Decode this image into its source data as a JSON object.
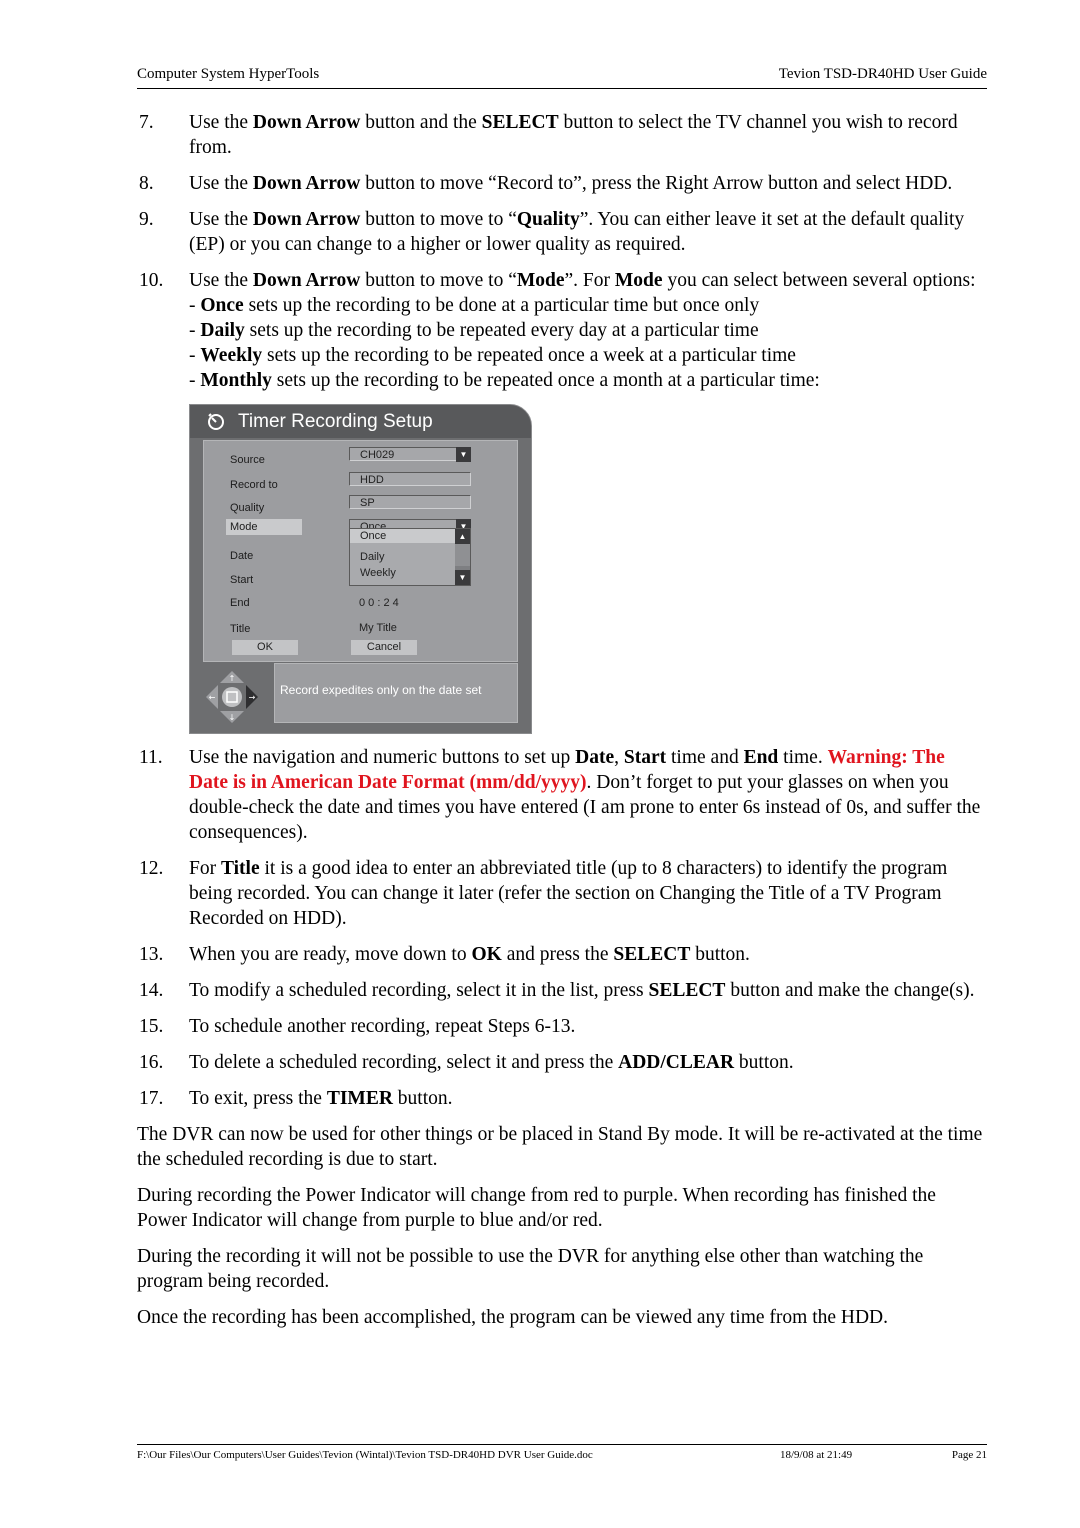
{
  "header": {
    "left": "Computer System HyperTools",
    "right": "Tevion TSD-DR40HD User Guide"
  },
  "steps": [
    {
      "num": "7.",
      "parts": [
        [
          "Use the ",
          false
        ],
        [
          "Down Arrow",
          true
        ],
        [
          " button and the ",
          false
        ],
        [
          "SELECT",
          true
        ],
        [
          " button to select the TV channel you wish to record from.",
          false
        ]
      ]
    },
    {
      "num": "8.",
      "parts": [
        [
          "Use the ",
          false
        ],
        [
          "Down Arrow",
          true
        ],
        [
          " button to move “Record to”, press the Right Arrow button and select HDD.",
          false
        ]
      ]
    },
    {
      "num": "9.",
      "parts": [
        [
          "Use the ",
          false
        ],
        [
          "Down Arrow",
          true
        ],
        [
          " button to move to “",
          false
        ],
        [
          "Quality",
          true
        ],
        [
          "”. You can either leave it set at the default quality (EP) or you can change to a higher or lower quality as required.",
          false
        ]
      ]
    },
    {
      "num": "10.",
      "parts": [
        [
          "Use the ",
          false
        ],
        [
          "Down Arrow",
          true
        ],
        [
          " button to move to “",
          false
        ],
        [
          "Mode",
          true
        ],
        [
          "”. For ",
          false
        ],
        [
          "Mode",
          true
        ],
        [
          " you can select between several options:",
          false
        ]
      ],
      "options": [
        {
          "term": "Once",
          "desc": " sets up the recording to be done at a particular time but once only"
        },
        {
          "term": "Daily",
          "desc": " sets up the recording to be repeated every day at a particular time"
        },
        {
          "term": "Weekly",
          "desc": " sets up the recording to be repeated once a week at a particular time"
        },
        {
          "term": "Monthly",
          "desc": " sets up the recording to be repeated once a month at a particular time:"
        }
      ]
    }
  ],
  "screenshot": {
    "title": "Timer Recording Setup",
    "labels": {
      "source": "Source",
      "record_to": "Record to",
      "quality": "Quality",
      "mode": "Mode",
      "date": "Date",
      "start": "Start",
      "end": "End",
      "title": "Title"
    },
    "values": {
      "source": "CH029",
      "record_to": "HDD",
      "quality": "SP",
      "mode": "Once",
      "end": "0 0 : 2 4",
      "title": "My Title"
    },
    "mode_options": [
      "Once",
      "Daily",
      "Weekly"
    ],
    "ok": "OK",
    "cancel": "Cancel",
    "message": "Record expedites only on the date set",
    "dropdown_arrow": "▼",
    "scroll_up": "▲",
    "scroll_down": "▼"
  },
  "steps2": [
    {
      "num": "11.",
      "parts": [
        [
          "Use the navigation and numeric buttons to set up ",
          false
        ],
        [
          "Date",
          true
        ],
        [
          ", ",
          false
        ],
        [
          "Start",
          true
        ],
        [
          " time and ",
          false
        ],
        [
          "End",
          true
        ],
        [
          " time. ",
          false
        ]
      ],
      "warning": "Warning: The Date is in American Date Format (mm/dd/yyyy)",
      "after": ". Don’t forget to put your glasses on when you double-check the date and times you have entered (I am prone to enter 6s instead of 0s, and suffer the consequences)."
    },
    {
      "num": "12.",
      "parts": [
        [
          "For ",
          false
        ],
        [
          "Title",
          true
        ],
        [
          " it is a good idea to enter an abbreviated title (up to 8 characters) to identify the program being recorded. You can change it later (refer the section on Changing the Title of a TV Program Recorded on HDD).",
          false
        ]
      ]
    },
    {
      "num": "13.",
      "parts": [
        [
          "When you are ready, move down to ",
          false
        ],
        [
          "OK",
          true
        ],
        [
          " and press the ",
          false
        ],
        [
          "SELECT",
          true
        ],
        [
          " button.",
          false
        ]
      ]
    },
    {
      "num": "14.",
      "parts": [
        [
          "To modify a scheduled recording, select it in the list, press ",
          false
        ],
        [
          "SELECT",
          true
        ],
        [
          " button and make the change(s).",
          false
        ]
      ]
    },
    {
      "num": "15.",
      "parts": [
        [
          "To schedule another recording, repeat Steps 6-13.",
          false
        ]
      ]
    },
    {
      "num": "16.",
      "parts": [
        [
          "To delete a scheduled recording, select it and press the ",
          false
        ],
        [
          "ADD/CLEAR",
          true
        ],
        [
          " button.",
          false
        ]
      ]
    },
    {
      "num": "17.",
      "parts": [
        [
          "To exit, press the ",
          false
        ],
        [
          "TIMER",
          true
        ],
        [
          " button.",
          false
        ]
      ]
    }
  ],
  "paragraphs": [
    "The DVR can now be used for other things or be placed in Stand By mode. It will be re-activated at the time the scheduled recording is due to start.",
    "During recording the Power Indicator will change from red to purple. When recording has finished the Power Indicator will change from purple to blue and/or red.",
    "During the recording it will not be possible to use the DVR for anything else other than watching the program being recorded.",
    "Once the recording has been accomplished, the program can be viewed any time from the HDD."
  ],
  "footer": {
    "path": "F:\\Our Files\\Our Computers\\User Guides\\Tevion (Wintal)\\Tevion TSD-DR40HD DVR User Guide.doc",
    "date": "18/9/08 at 21:49",
    "page": "Page 21"
  },
  "colors": {
    "warning": "#e0141e",
    "panel_bg": "#6d6e70",
    "form_bg": "#9c9da0"
  }
}
